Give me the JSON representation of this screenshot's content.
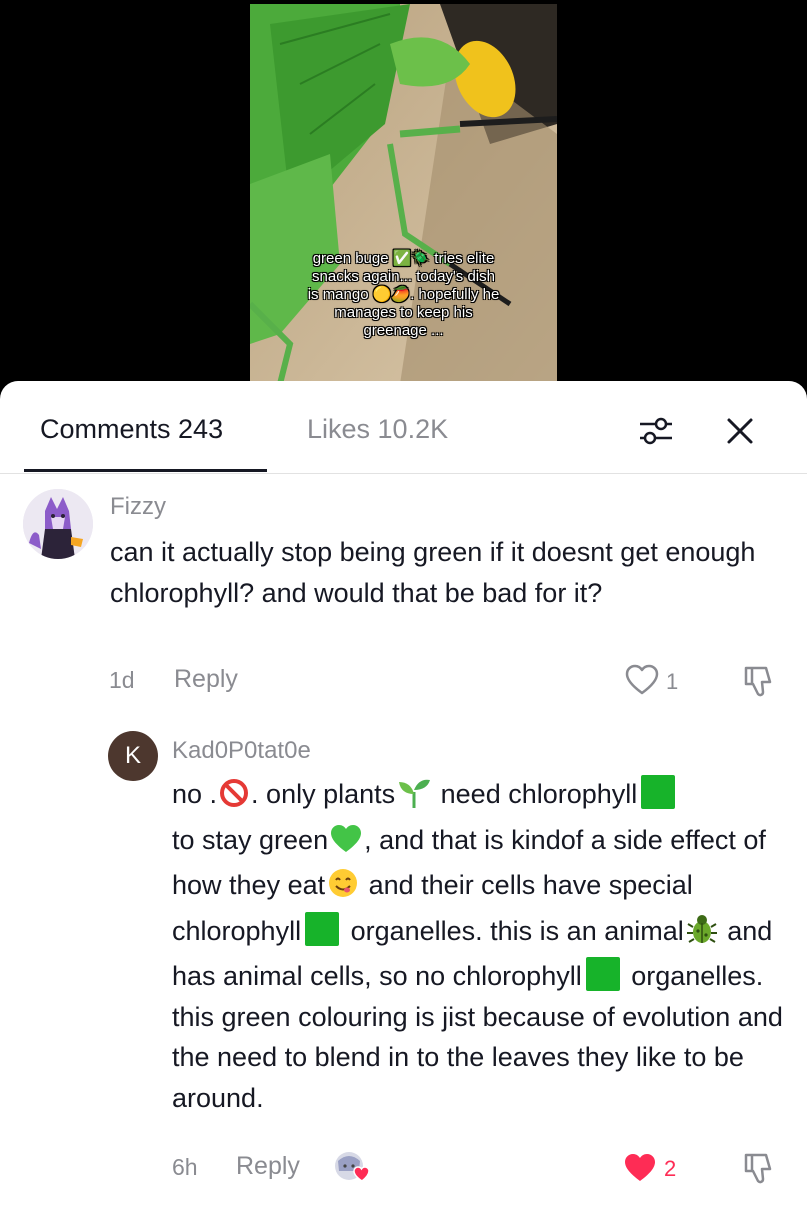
{
  "video": {
    "caption_lines": [
      "green buge ✅🪲 tries elite",
      "snacks again... today's dish",
      "is mango 🟡🥭. hopefully he",
      "manages to keep his",
      "greenage ..."
    ]
  },
  "tabs": {
    "comments": "Comments 243",
    "likes": "Likes 10.2K"
  },
  "comments": [
    {
      "username": "Fizzy",
      "text": "can it actually stop being green if it doesnt get enough chlorophyll? and would that be bad for it?",
      "time": "1d",
      "reply": "Reply",
      "likes": "1"
    },
    {
      "username": "Kad0P0tat0e",
      "avatar_letter": "K",
      "text_parts": {
        "p1": "no .",
        "p2": ". only plants",
        "p3": " need chlorophyll",
        "p4": "to stay green",
        "p5": ", and that is kindof a side effect of how they eat",
        "p6": " and their cells have special chlorophyll",
        "p7": " organelles. this is an animal",
        "p8": " and has animal cells, so no chlorophyll",
        "p9": " organelles. this green colouring is jist because of evolution and the need to blend in to the leaves they like to be around."
      },
      "time": "6h",
      "reply": "Reply",
      "likes": "2",
      "liked_color": "#fe2c55"
    }
  ]
}
